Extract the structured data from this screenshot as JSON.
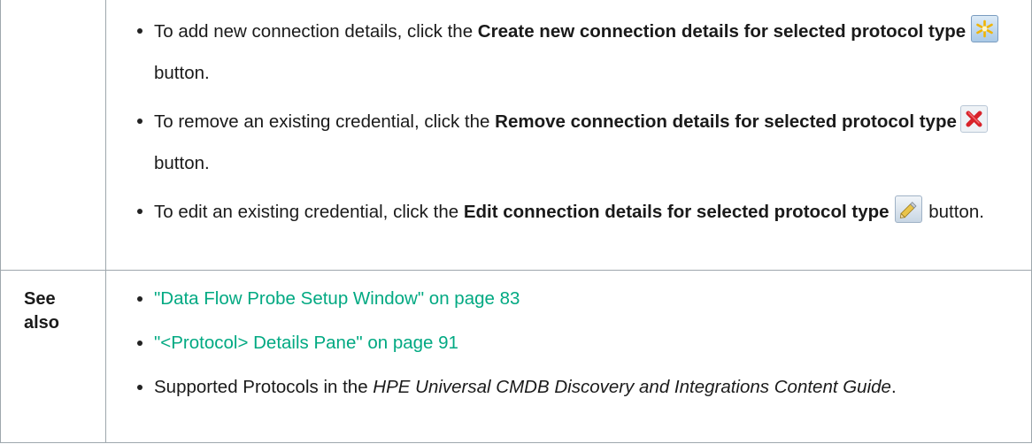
{
  "instructions": {
    "create": {
      "prefix": "To add new connection details, click the ",
      "bold": "Create new connection details for selected protocol type",
      "suffix": " button.",
      "icon": "asterisk-create-icon"
    },
    "remove": {
      "prefix": "To remove an existing credential, click the ",
      "bold": "Remove connection details for selected protocol type",
      "suffix": "button.",
      "icon": "red-x-remove-icon"
    },
    "edit": {
      "prefix": "To edit an existing credential, click the ",
      "bold": "Edit connection details for selected protocol type",
      "suffix": " button.",
      "icon": "pencil-edit-icon"
    }
  },
  "see_also": {
    "label": "See also",
    "links": [
      "\"Data Flow Probe Setup Window\" on page 83",
      "\"<Protocol> Details Pane\" on page 91"
    ],
    "note": {
      "prefix": "Supported Protocols in the ",
      "italic": "HPE Universal CMDB Discovery and Integrations Content Guide",
      "suffix": "."
    }
  },
  "colors": {
    "link": "#01a982",
    "border": "#9ea7ad",
    "text": "#1a1a1a"
  }
}
